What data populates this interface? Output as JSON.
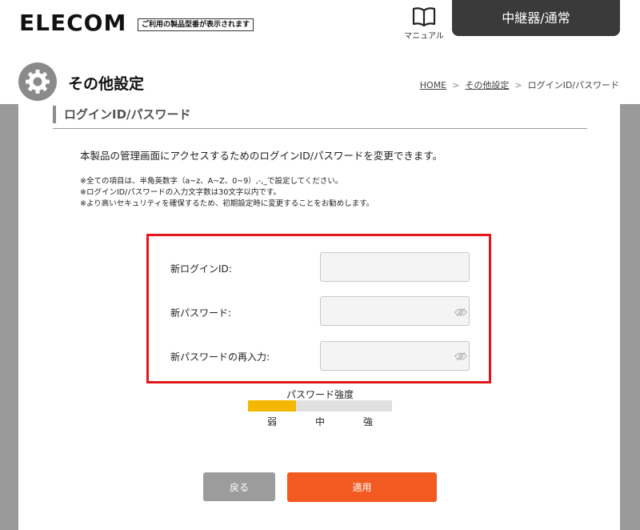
{
  "header": {
    "logo": "ELECOM",
    "model_note": "ご利用の製品型番が表示されます",
    "manual_label": "マニュアル",
    "manual_icon": "book-icon",
    "mode_tab": "中継器/通常"
  },
  "page": {
    "icon": "gear-icon",
    "title": "その他設定",
    "breadcrumb": [
      "HOME",
      "その他設定",
      "ログインID/パスワード"
    ],
    "breadcrumb_sep": ">"
  },
  "section": {
    "title": "ログインID/パスワード",
    "description": "本製品の管理画面にアクセスするためのログインID/パスワードを変更できます。",
    "notes": [
      "※全ての項目は、半角英数字（a~z、A~Z、0~9）,-,_で設定してください。",
      "※ログインID/パスワードの入力文字数は30文字以内です。",
      "※より高いセキュリティを確保するため、初期設定時に変更することをお勧めします。"
    ]
  },
  "form": {
    "highlight_color": "#e0161b",
    "fields": [
      {
        "label": "新ログインID:",
        "value": "",
        "type": "text"
      },
      {
        "label": "新パスワード:",
        "value": "",
        "type": "password",
        "icon": "eye-slash-icon"
      },
      {
        "label": "新パスワードの再入力:",
        "value": "",
        "type": "password",
        "icon": "eye-slash-icon"
      }
    ]
  },
  "strength": {
    "label": "パスワード強度",
    "levels": [
      "弱",
      "中",
      "強"
    ],
    "level_value": 0.333,
    "fill_color": "#f5b800"
  },
  "buttons": {
    "back": "戻る",
    "apply": "適用",
    "apply_color": "#f25a22"
  }
}
